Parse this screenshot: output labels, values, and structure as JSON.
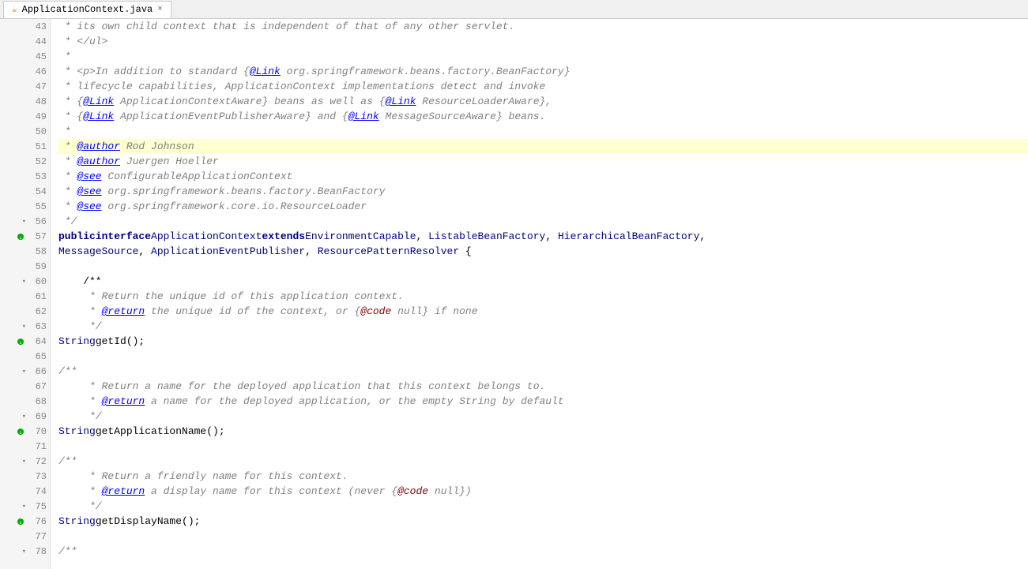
{
  "tab": {
    "filename": "ApplicationContext.java",
    "icon": "☕",
    "close": "×"
  },
  "colors": {
    "background": "#ffffff",
    "gutter_bg": "#f5f5f5",
    "highlight_line": "#ffffd0",
    "comment": "#808080",
    "keyword": "#000080",
    "link": "#0000ff",
    "tag": "#008000"
  },
  "lines": [
    {
      "num": 43,
      "fold": false,
      "method": false,
      "highlighted": false
    },
    {
      "num": 44,
      "fold": false,
      "method": false,
      "highlighted": false
    },
    {
      "num": 45,
      "fold": false,
      "method": false,
      "highlighted": false
    },
    {
      "num": 46,
      "fold": false,
      "method": false,
      "highlighted": false
    },
    {
      "num": 47,
      "fold": false,
      "method": false,
      "highlighted": false
    },
    {
      "num": 48,
      "fold": false,
      "method": false,
      "highlighted": false
    },
    {
      "num": 49,
      "fold": false,
      "method": false,
      "highlighted": false
    },
    {
      "num": 50,
      "fold": false,
      "method": false,
      "highlighted": false
    },
    {
      "num": 51,
      "fold": false,
      "method": false,
      "highlighted": true
    },
    {
      "num": 52,
      "fold": false,
      "method": false,
      "highlighted": false
    },
    {
      "num": 53,
      "fold": false,
      "method": false,
      "highlighted": false
    },
    {
      "num": 54,
      "fold": false,
      "method": false,
      "highlighted": false
    },
    {
      "num": 55,
      "fold": false,
      "method": false,
      "highlighted": false
    },
    {
      "num": 56,
      "fold": true,
      "method": false,
      "highlighted": false
    },
    {
      "num": 57,
      "fold": false,
      "method": true,
      "highlighted": false
    },
    {
      "num": 58,
      "fold": false,
      "method": false,
      "highlighted": false
    },
    {
      "num": 59,
      "fold": false,
      "method": false,
      "highlighted": false
    },
    {
      "num": 60,
      "fold": true,
      "method": false,
      "highlighted": false
    },
    {
      "num": 61,
      "fold": false,
      "method": false,
      "highlighted": false
    },
    {
      "num": 62,
      "fold": false,
      "method": false,
      "highlighted": false
    },
    {
      "num": 63,
      "fold": true,
      "method": false,
      "highlighted": false
    },
    {
      "num": 64,
      "fold": false,
      "method": true,
      "highlighted": false
    },
    {
      "num": 65,
      "fold": false,
      "method": false,
      "highlighted": false
    },
    {
      "num": 66,
      "fold": true,
      "method": false,
      "highlighted": false
    },
    {
      "num": 67,
      "fold": false,
      "method": false,
      "highlighted": false
    },
    {
      "num": 68,
      "fold": false,
      "method": false,
      "highlighted": false
    },
    {
      "num": 69,
      "fold": true,
      "method": false,
      "highlighted": false
    },
    {
      "num": 70,
      "fold": false,
      "method": true,
      "highlighted": false
    },
    {
      "num": 71,
      "fold": false,
      "method": false,
      "highlighted": false
    },
    {
      "num": 72,
      "fold": true,
      "method": false,
      "highlighted": false
    },
    {
      "num": 73,
      "fold": false,
      "method": false,
      "highlighted": false
    },
    {
      "num": 74,
      "fold": false,
      "method": false,
      "highlighted": false
    },
    {
      "num": 75,
      "fold": true,
      "method": false,
      "highlighted": false
    },
    {
      "num": 76,
      "fold": false,
      "method": true,
      "highlighted": false
    },
    {
      "num": 77,
      "fold": false,
      "method": false,
      "highlighted": false
    },
    {
      "num": 78,
      "fold": true,
      "method": false,
      "highlighted": false
    }
  ]
}
